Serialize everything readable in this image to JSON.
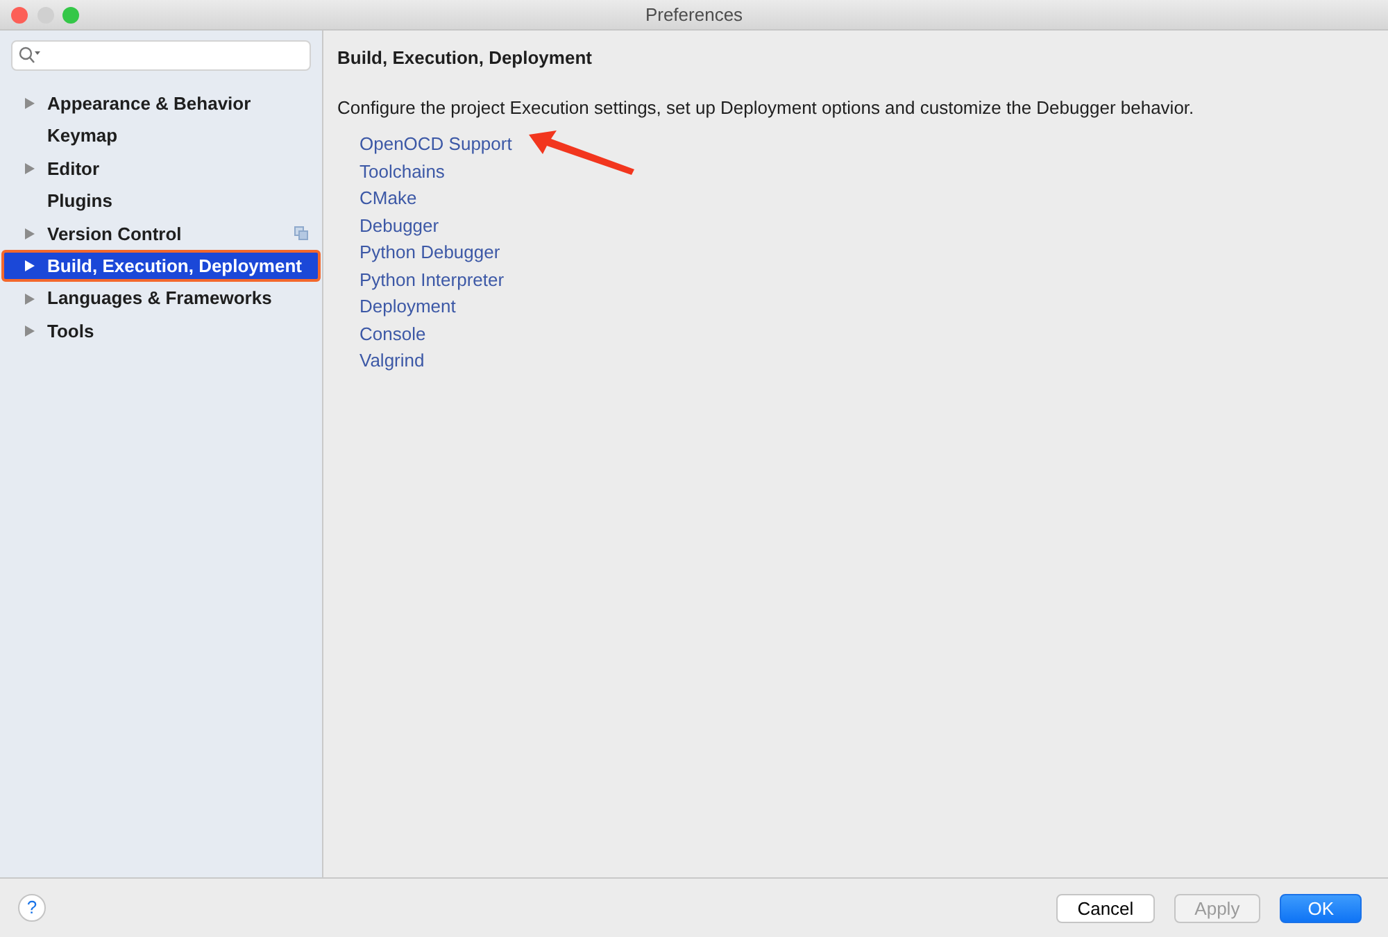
{
  "window": {
    "title": "Preferences"
  },
  "sidebar": {
    "items": [
      {
        "label": "Appearance & Behavior",
        "expandable": true,
        "selected": false,
        "highlighted": false,
        "project_icon": false
      },
      {
        "label": "Keymap",
        "expandable": false,
        "selected": false,
        "highlighted": false,
        "project_icon": false
      },
      {
        "label": "Editor",
        "expandable": true,
        "selected": false,
        "highlighted": false,
        "project_icon": false
      },
      {
        "label": "Plugins",
        "expandable": false,
        "selected": false,
        "highlighted": false,
        "project_icon": false
      },
      {
        "label": "Version Control",
        "expandable": true,
        "selected": false,
        "highlighted": false,
        "project_icon": true
      },
      {
        "label": "Build, Execution, Deployment",
        "expandable": true,
        "selected": true,
        "highlighted": true,
        "project_icon": false
      },
      {
        "label": "Languages & Frameworks",
        "expandable": true,
        "selected": false,
        "highlighted": false,
        "project_icon": false
      },
      {
        "label": "Tools",
        "expandable": true,
        "selected": false,
        "highlighted": false,
        "project_icon": false
      }
    ]
  },
  "content": {
    "title": "Build, Execution, Deployment",
    "description": "Configure the project Execution settings, set up Deployment options and customize the Debugger behavior.",
    "links": [
      {
        "label": "OpenOCD Support",
        "pointed_at": true
      },
      {
        "label": "Toolchains",
        "pointed_at": false
      },
      {
        "label": "CMake",
        "pointed_at": false
      },
      {
        "label": "Debugger",
        "pointed_at": false
      },
      {
        "label": "Python Debugger",
        "pointed_at": false
      },
      {
        "label": "Python Interpreter",
        "pointed_at": false
      },
      {
        "label": "Deployment",
        "pointed_at": false
      },
      {
        "label": "Console",
        "pointed_at": false
      },
      {
        "label": "Valgrind",
        "pointed_at": false
      }
    ]
  },
  "footer": {
    "help": "?",
    "buttons": [
      {
        "label": "Cancel",
        "kind": "normal",
        "disabled": false
      },
      {
        "label": "Apply",
        "kind": "normal",
        "disabled": true
      },
      {
        "label": "OK",
        "kind": "default",
        "disabled": false
      }
    ]
  }
}
